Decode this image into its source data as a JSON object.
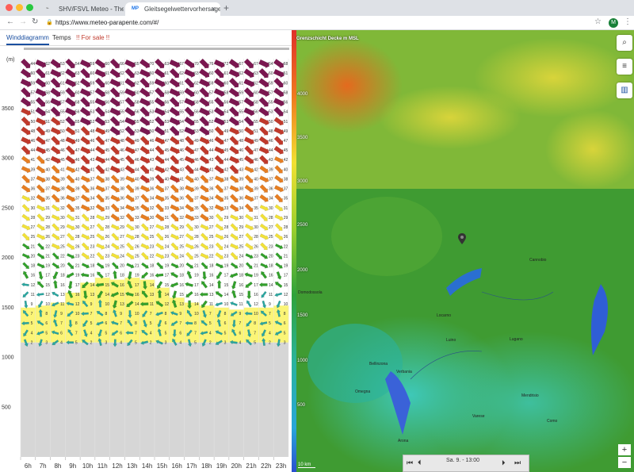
{
  "browser": {
    "tabs": [
      {
        "label": "SHV/FSVL Meteo - Thermikpro",
        "favicon": "",
        "active": false
      },
      {
        "label": "Gleitsegelwettervorhersage | M",
        "favicon": "MP",
        "active": true
      }
    ],
    "url": "https://www.meteo-parapente.com/#/",
    "avatar": "M"
  },
  "left": {
    "tabs": [
      "Winddiagramm",
      "Temps",
      "!! For sale !!"
    ],
    "unit": "(m)",
    "chart_data": {
      "type": "wind-grid",
      "hours": [
        "6h",
        "7h",
        "8h",
        "9h",
        "10h",
        "11h",
        "12h",
        "13h",
        "14h",
        "15h",
        "16h",
        "17h",
        "18h",
        "19h",
        "20h",
        "21h",
        "22h",
        "23h"
      ],
      "yticks": [
        500,
        1000,
        1500,
        2000,
        2500,
        3000,
        3500
      ],
      "ylim": [
        0,
        4000
      ],
      "ground_level_m": 1150,
      "colors": {
        "calm": "#2aa6a0",
        "light": "#33a02c",
        "moderate": "#f1e13a",
        "strong": "#e67e22",
        "very_strong": "#c0392b",
        "extreme": "#7b1750",
        "bl": "#fbf576",
        "ground": "#d6d6d6"
      },
      "first_row_values": [
        44,
        62,
        53,
        54,
        59,
        60,
        66,
        65,
        70,
        63,
        67,
        70,
        76,
        72,
        67,
        67,
        64,
        68
      ]
    }
  },
  "map": {
    "legend_title": "Grenzschicht Decke m MSL",
    "ticks": [
      4000,
      3500,
      3000,
      2500,
      2000,
      1500,
      1000,
      500
    ],
    "time_label": "Sa. 9. - 13:00",
    "scale_label": "10 km",
    "cities": [
      "Bellinzona",
      "Locarno",
      "Domodossola",
      "Verbania",
      "Lugano",
      "Luino",
      "Varese",
      "Mendrisio",
      "Omegna",
      "Arona",
      "Como",
      "Cannobio"
    ],
    "zoom_in": "+",
    "zoom_out": "−"
  }
}
